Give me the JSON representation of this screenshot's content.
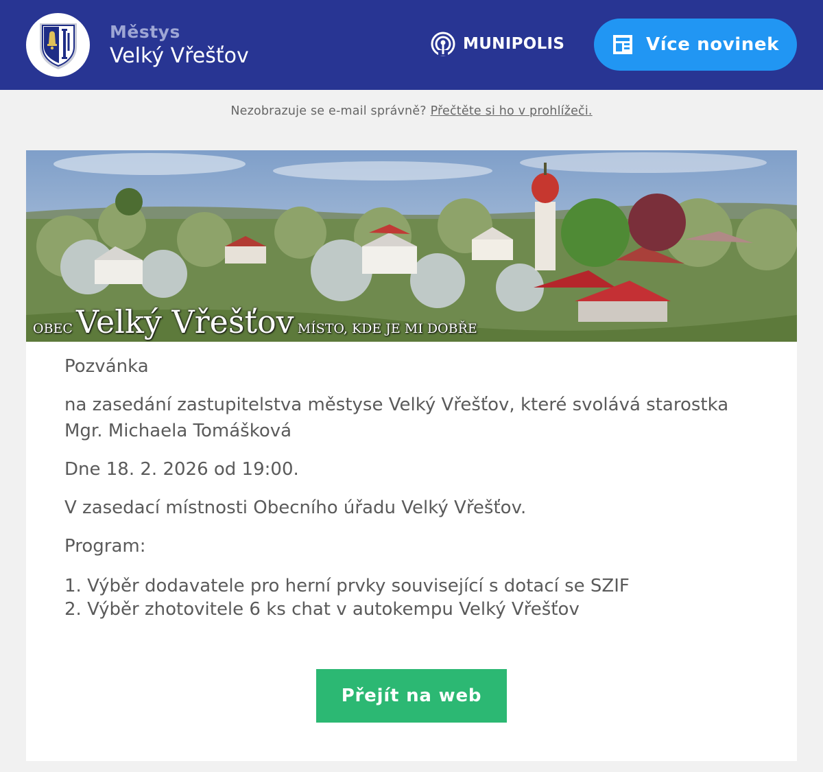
{
  "header": {
    "org_type": "Městys",
    "org_name": "Velký Vřešťov",
    "crest_icon": "coat-of-arms-icon",
    "brand": "MUNIPOLIS",
    "brand_icon": "broadcast-icon",
    "more_news_label": "Více novinek",
    "more_news_icon": "news-icon",
    "colors": {
      "header_bg": "#283593",
      "button_bg": "#2196f3",
      "cta_bg": "#2cb873"
    }
  },
  "notice": {
    "text": "Nezobrazuje se e-mail správně?",
    "link": "Přečtěte si ho v prohlížeči."
  },
  "banner": {
    "caption_prefix": "OBEC",
    "caption_name": "Velký Vřešťov",
    "caption_tagline": "MÍSTO, KDE JE MI DOBŘE"
  },
  "message": {
    "title": "Pozvánka",
    "intro": "na zasedání zastupitelstva městyse Velký Vřešťov, které svolává starostka Mgr. Michaela Tomášková",
    "date": "Dne 18. 2. 2026 od 19:00.",
    "place": "V zasedací místnosti Obecního úřadu Velký Vřešťov.",
    "program_label": "Program:",
    "agenda": [
      "1. Výběr dodavatele pro herní prvky související s dotací se SZIF",
      "2. Výběr zhotovitele 6 ks chat v autokempu Velký Vřešťov"
    ],
    "cta_label": "Přejít na web"
  }
}
